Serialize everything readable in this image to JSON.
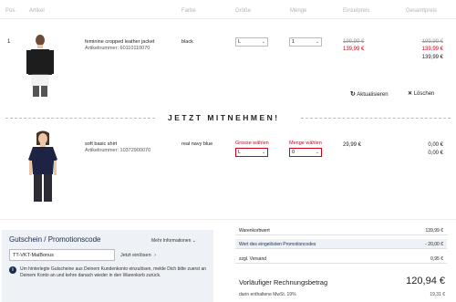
{
  "header": {
    "pos": "Pos.",
    "artikel": "Artikel",
    "farbe": "Farbe",
    "groesse": "Größe",
    "menge": "Menge",
    "einzelpreis": "Einzelpreis",
    "gesamtpreis": "Gesamtpreis"
  },
  "item1": {
    "pos": "1",
    "name": "feminine cropped leather jacket",
    "article": "Artikelnummer: 60110110070",
    "color": "black",
    "size": "L",
    "qty": "1",
    "unit_old": "199,99 €",
    "unit_new": "139,99 €",
    "total_old": "199,99 €",
    "total_new": "139,99 €",
    "total": "139,99 €",
    "update_label": "Aktualisieren",
    "delete_label": "Löschen"
  },
  "divider": {
    "text": "JETZT MITNEHMEN!"
  },
  "item2": {
    "name": "soft basic shirt",
    "article": "Artikelnummer: 10372900070",
    "color": "real navy blue",
    "size_hint": "Grosse wählen",
    "qty_hint": "Menge wählen",
    "size": "L",
    "qty": "0",
    "unit": "29,99 €",
    "total_small": "0,00 €",
    "total": "0,00 €"
  },
  "coupon": {
    "title": "Gutschein / Promotionscode",
    "more_info": "Mehr Informationen",
    "input_value": "TT-VKT-MaiBonus",
    "redeem": "Jetzt einlösen",
    "info_text": "Um hinterlegte Gutscheine aus Deinem Kundenkonto einzulösen, melde Dich bitte zuerst an Deinem Konto an und kehre danach wieder in den Warenkorb zurück."
  },
  "summary": {
    "rows": [
      {
        "label": "Warenkorbwert",
        "value": "139,99 €"
      },
      {
        "label": "Wert des eingelösten Promotioncodes",
        "value": "- 20,00 €"
      },
      {
        "label": "zzgl. Versand",
        "value": "0,95 €"
      }
    ],
    "total_label": "Vorläufiger Rechnungsbetrag",
    "total_value": "120,94 €",
    "vat_label": "darin enthaltene MwSt. 19%",
    "vat_value": "19,31 €"
  },
  "colors": {
    "accent_red": "#d0021b",
    "panel_bg": "#eef1f5",
    "text": "#222222"
  }
}
